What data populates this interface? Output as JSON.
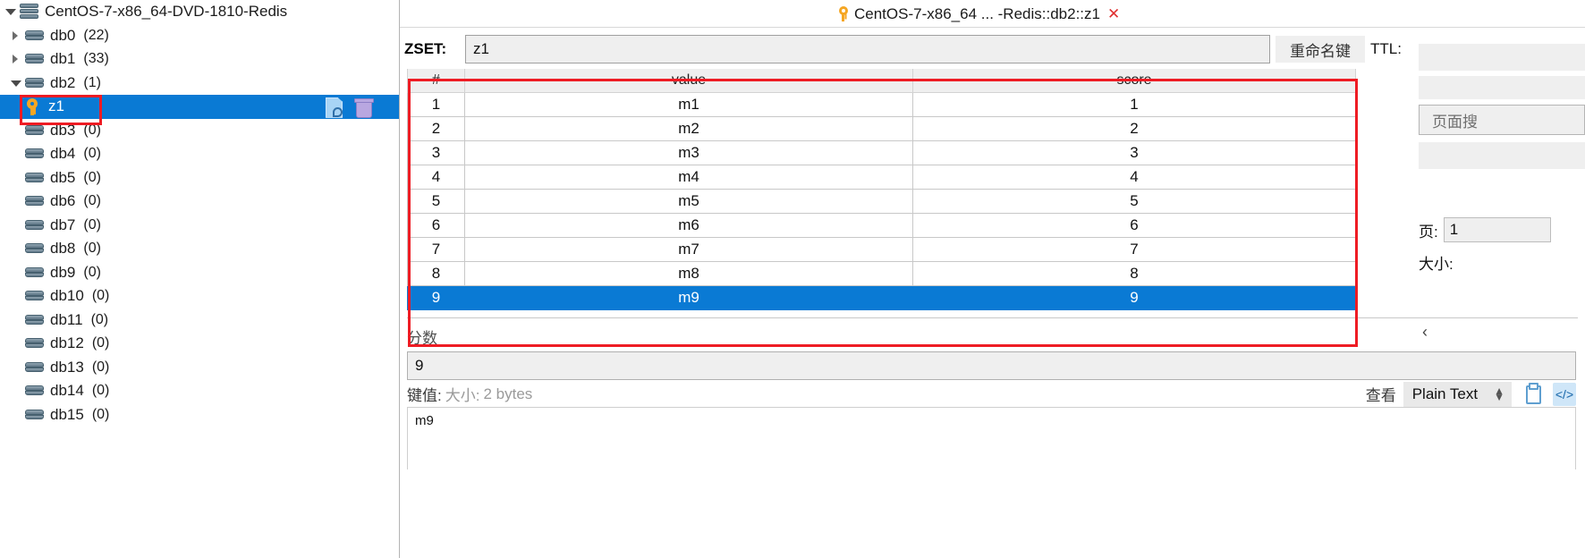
{
  "tree": {
    "root": {
      "label": "CentOS-7-x86_64-DVD-1810-Redis",
      "icon": "server-icon",
      "expanded": true
    },
    "nodes": [
      {
        "label": "db0",
        "count": "(22)",
        "icon": "database-icon",
        "expanded": false
      },
      {
        "label": "db1",
        "count": "(33)",
        "icon": "database-icon",
        "expanded": false
      },
      {
        "label": "db2",
        "count": "(1)",
        "icon": "database-icon",
        "expanded": true
      },
      {
        "label": "z1",
        "count": "",
        "icon": "key-icon",
        "selected": true,
        "child": true
      },
      {
        "label": "db3",
        "count": "(0)",
        "icon": "database-icon",
        "expanded": false
      },
      {
        "label": "db4",
        "count": "(0)",
        "icon": "database-icon",
        "expanded": false
      },
      {
        "label": "db5",
        "count": "(0)",
        "icon": "database-icon",
        "expanded": false
      },
      {
        "label": "db6",
        "count": "(0)",
        "icon": "database-icon",
        "expanded": false
      },
      {
        "label": "db7",
        "count": "(0)",
        "icon": "database-icon",
        "expanded": false
      },
      {
        "label": "db8",
        "count": "(0)",
        "icon": "database-icon",
        "expanded": false
      },
      {
        "label": "db9",
        "count": "(0)",
        "icon": "database-icon",
        "expanded": false
      },
      {
        "label": "db10",
        "count": "(0)",
        "icon": "database-icon",
        "expanded": false
      },
      {
        "label": "db11",
        "count": "(0)",
        "icon": "database-icon",
        "expanded": false
      },
      {
        "label": "db12",
        "count": "(0)",
        "icon": "database-icon",
        "expanded": false
      },
      {
        "label": "db13",
        "count": "(0)",
        "icon": "database-icon",
        "expanded": false
      },
      {
        "label": "db14",
        "count": "(0)",
        "icon": "database-icon",
        "expanded": false
      },
      {
        "label": "db15",
        "count": "(0)",
        "icon": "database-icon",
        "expanded": false
      }
    ]
  },
  "tab": {
    "title": "CentOS-7-x86_64 ... -Redis::db2::z1",
    "close": "✕",
    "icon": "key-icon"
  },
  "editor": {
    "type_label": "ZSET:",
    "key_value": "z1",
    "rename_button": "重命名键",
    "ttl_label": "TTL:"
  },
  "table": {
    "columns": [
      "#",
      "value",
      "score"
    ],
    "rows": [
      {
        "index": "1",
        "value": "m1",
        "score": "1",
        "selected": false
      },
      {
        "index": "2",
        "value": "m2",
        "score": "2",
        "selected": false
      },
      {
        "index": "3",
        "value": "m3",
        "score": "3",
        "selected": false
      },
      {
        "index": "4",
        "value": "m4",
        "score": "4",
        "selected": false
      },
      {
        "index": "5",
        "value": "m5",
        "score": "5",
        "selected": false
      },
      {
        "index": "6",
        "value": "m6",
        "score": "6",
        "selected": false
      },
      {
        "index": "7",
        "value": "m7",
        "score": "7",
        "selected": false
      },
      {
        "index": "8",
        "value": "m8",
        "score": "8",
        "selected": false
      },
      {
        "index": "9",
        "value": "m9",
        "score": "9",
        "selected": true
      }
    ]
  },
  "side": {
    "page_search_placeholder": "页面搜",
    "page_label": "页:",
    "page_value": "1",
    "size_label": "大小:",
    "nav_prev": "‹"
  },
  "score_section": {
    "label": "分数",
    "value": "9"
  },
  "value_section": {
    "key_label": "键值:",
    "size_label": "大小:",
    "size_value": "2 bytes",
    "view_label": "查看",
    "format": "Plain Text",
    "content": "m9",
    "copy_icon": "clipboard-icon",
    "code_icon": "code-icon"
  },
  "colors": {
    "selection": "#0a7ad4",
    "highlight": "#ee1c24",
    "key_icon": "#f5a623"
  }
}
